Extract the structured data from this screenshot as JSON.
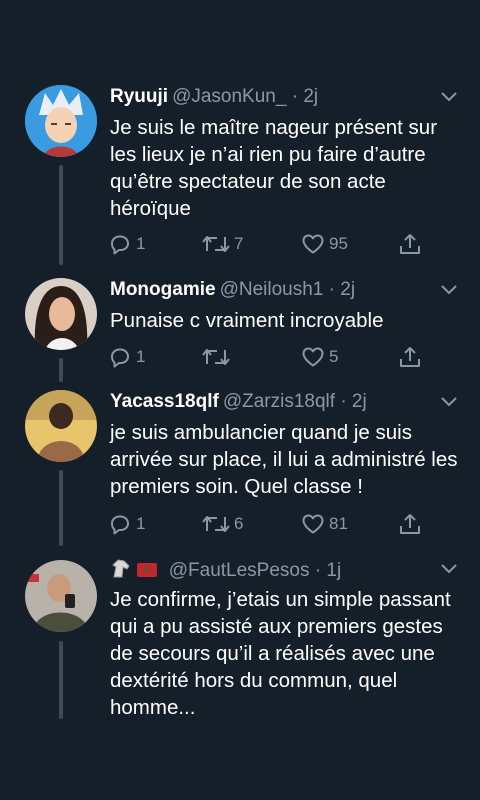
{
  "tweets": [
    {
      "name": "Ryuuji",
      "handle": "@JasonKun_",
      "time": "· 2j",
      "text": "Je suis le maître nageur présent sur les lieux je n’ai rien pu faire d’autre qu’être spectateur de son acte héroïque",
      "replies": "1",
      "retweets": "7",
      "likes": "95"
    },
    {
      "name": "Monogamie",
      "handle": "@Neiloush1",
      "time": "· 2j",
      "text": "Punaise c vraiment incroyable",
      "replies": "1",
      "retweets": "",
      "likes": "5"
    },
    {
      "name": "Yacass18qlf",
      "handle": "@Zarzis18qlf",
      "time": "· 2j",
      "text": "je suis ambulancier quand je suis arrivée sur place, il lui a administré les premiers soin. Quel classe !",
      "replies": "1",
      "retweets": "6",
      "likes": "81"
    },
    {
      "name": "🐴 ■",
      "handle": "@FautLesPesos",
      "time": "· 1j",
      "text": "Je confirme, j’etais un simple passant qui a pu assisté aux premiers gestes de secours qu’il a réalisés avec une dextérité hors du commun, quel homme...",
      "replies": "",
      "retweets": "",
      "likes": ""
    }
  ],
  "icons": {
    "reply": "reply-icon",
    "retweet": "retweet-icon",
    "like": "heart-icon",
    "share": "share-icon",
    "more": "chevron-down-icon"
  },
  "colors": {
    "background": "#151f2a",
    "muted": "#8899a6",
    "thread": "#3d4a57"
  }
}
